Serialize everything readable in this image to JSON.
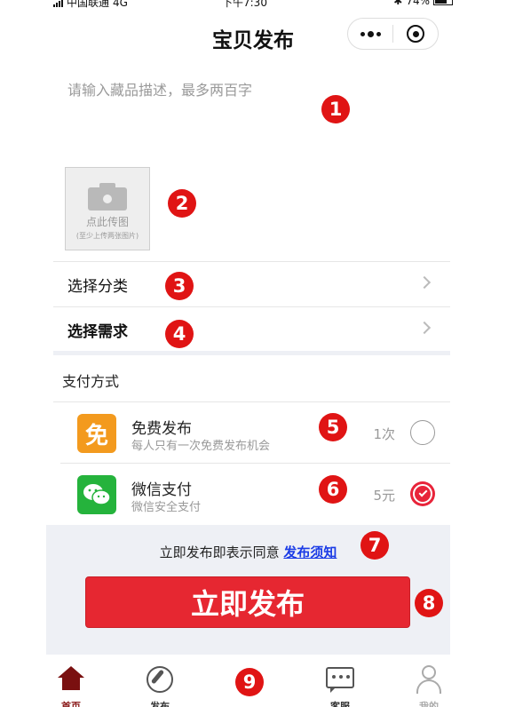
{
  "status_bar": {
    "carrier": "中国联通",
    "network": "4G",
    "time": "下午7:30",
    "battery": "74%"
  },
  "navbar": {
    "title": "宝贝发布",
    "more_icon": "more-dots-icon",
    "close_icon": "target-icon"
  },
  "description": {
    "placeholder": "请输入藏品描述，最多两百字"
  },
  "upload": {
    "label": "点此传图",
    "hint": "(至少上传两张图片)",
    "icon": "camera-icon"
  },
  "category": {
    "label": "选择分类"
  },
  "demand": {
    "label": "选择需求"
  },
  "payment": {
    "title": "支付方式",
    "methods": [
      {
        "icon_text": "免",
        "name": "免费发布",
        "sub": "每人只有一次免费发布机会",
        "price": "1次",
        "selected": false
      },
      {
        "icon": "wechat-icon",
        "name": "微信支付",
        "sub": "微信安全支付",
        "price": "5元",
        "selected": true
      }
    ]
  },
  "agreement": {
    "text": "立即发布即表示同意",
    "link": "发布须知"
  },
  "publish_button": {
    "label": "立即发布"
  },
  "tabbar": [
    {
      "label": "首页",
      "icon": "home-icon"
    },
    {
      "label": "发布",
      "icon": "compass-icon"
    },
    {
      "label": "客服",
      "icon": "chat-icon"
    },
    {
      "label": "我的",
      "icon": "user-icon"
    }
  ],
  "markers": [
    "1",
    "2",
    "3",
    "4",
    "5",
    "6",
    "7",
    "8",
    "9"
  ],
  "colors": {
    "accent": "#e62731",
    "free_icon": "#f39a1e",
    "wechat": "#25b33c",
    "link": "#1a3be6"
  }
}
